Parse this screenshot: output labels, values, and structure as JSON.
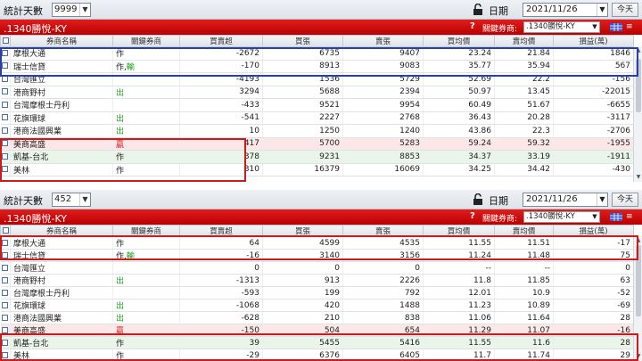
{
  "labels": {
    "days_label": "統計天數",
    "date_label": "日期",
    "today_button": "今天",
    "broker_label": "關鍵券商:",
    "help": "?"
  },
  "columns": [
    "券商名稱",
    "關鍵券商",
    "買賣超",
    "買張",
    "賣張",
    "買均價",
    "賣均價",
    "損益(萬)"
  ],
  "panel1": {
    "days": "9999",
    "date": "2021/11/26",
    "stock": ".1340勝悅-KY",
    "broker_select": ".1340勝悅-KY",
    "rows": [
      {
        "name": "摩根大通",
        "key": "作",
        "net": "-2672",
        "buy": "6735",
        "sell": "9407",
        "bavg": "23.24",
        "savg": "21.84",
        "pl": "1846",
        "style": ""
      },
      {
        "name": "瑞士信貸",
        "key": "作,輸",
        "net": "-170",
        "buy": "8913",
        "sell": "9083",
        "bavg": "35.77",
        "savg": "35.94",
        "pl": "567",
        "style": ""
      },
      {
        "name": "台灣匯立",
        "key": "",
        "net": "-4193",
        "buy": "1536",
        "sell": "5729",
        "bavg": "52.69",
        "savg": "22.2",
        "pl": "-156",
        "style": ""
      },
      {
        "name": "港商野村",
        "key": "出",
        "net": "3294",
        "buy": "5688",
        "sell": "2394",
        "bavg": "50.97",
        "savg": "13.45",
        "pl": "-22015",
        "style": ""
      },
      {
        "name": "台灣摩根士丹利",
        "key": "",
        "net": "-433",
        "buy": "9521",
        "sell": "9954",
        "bavg": "60.49",
        "savg": "51.67",
        "pl": "-6655",
        "style": ""
      },
      {
        "name": "花旗環球",
        "key": "出",
        "net": "-541",
        "buy": "2227",
        "sell": "2768",
        "bavg": "36.43",
        "savg": "20.28",
        "pl": "-3117",
        "style": ""
      },
      {
        "name": "港商法國興業",
        "key": "出",
        "net": "10",
        "buy": "1250",
        "sell": "1240",
        "bavg": "43.86",
        "savg": "22.3",
        "pl": "-2706",
        "style": ""
      },
      {
        "name": "美商高盛",
        "key": "贏",
        "net": "417",
        "buy": "5700",
        "sell": "5283",
        "bavg": "59.24",
        "savg": "59.32",
        "pl": "-1955",
        "style": "red"
      },
      {
        "name": "凱基-台北",
        "key": "作",
        "net": "378",
        "buy": "9231",
        "sell": "8853",
        "bavg": "34.37",
        "savg": "33.19",
        "pl": "-1911",
        "style": "green"
      },
      {
        "name": "美林",
        "key": "作",
        "net": "310",
        "buy": "16379",
        "sell": "16069",
        "bavg": "34.25",
        "savg": "34.42",
        "pl": "-430",
        "style": ""
      }
    ]
  },
  "panel2": {
    "days": "452",
    "date": "2021/11/26",
    "stock": ".1340勝悅-KY",
    "broker_select": ".1340勝悅-KY",
    "rows": [
      {
        "name": "摩根大通",
        "key": "作",
        "net": "64",
        "buy": "4599",
        "sell": "4535",
        "bavg": "11.55",
        "savg": "11.51",
        "pl": "-17",
        "style": ""
      },
      {
        "name": "瑞士信貸",
        "key": "作,輸",
        "net": "-16",
        "buy": "3140",
        "sell": "3156",
        "bavg": "11.24",
        "savg": "11.48",
        "pl": "75",
        "style": ""
      },
      {
        "name": "台灣匯立",
        "key": "",
        "net": "0",
        "buy": "0",
        "sell": "0",
        "bavg": "--",
        "savg": "--",
        "pl": "0",
        "style": ""
      },
      {
        "name": "港商野村",
        "key": "出",
        "net": "-1313",
        "buy": "913",
        "sell": "2226",
        "bavg": "11.8",
        "savg": "11.85",
        "pl": "63",
        "style": ""
      },
      {
        "name": "台灣摩根士丹利",
        "key": "",
        "net": "-593",
        "buy": "199",
        "sell": "792",
        "bavg": "12.01",
        "savg": "10.9",
        "pl": "-52",
        "style": ""
      },
      {
        "name": "花旗環球",
        "key": "出",
        "net": "-1068",
        "buy": "420",
        "sell": "1488",
        "bavg": "11.23",
        "savg": "10.89",
        "pl": "-69",
        "style": ""
      },
      {
        "name": "港商法國興業",
        "key": "出",
        "net": "-628",
        "buy": "210",
        "sell": "838",
        "bavg": "11.06",
        "savg": "11.64",
        "pl": "28",
        "style": ""
      },
      {
        "name": "美商高盛",
        "key": "贏",
        "net": "-150",
        "buy": "504",
        "sell": "654",
        "bavg": "11.29",
        "savg": "11.07",
        "pl": "-16",
        "style": "red"
      },
      {
        "name": "凱基-台北",
        "key": "作",
        "net": "39",
        "buy": "5455",
        "sell": "5416",
        "bavg": "11.55",
        "savg": "11.6",
        "pl": "28",
        "style": "green"
      },
      {
        "name": "美林",
        "key": "作",
        "net": "-29",
        "buy": "6376",
        "sell": "6405",
        "bavg": "11.7",
        "savg": "11.74",
        "pl": "29",
        "style": ""
      }
    ]
  },
  "icons": {
    "lock": "unlock-icon",
    "grid": "grid-icon",
    "menu": "menu-icon"
  },
  "colors": {
    "title_red": "#d21414",
    "highlight_blue": "#2b3fa8",
    "highlight_red": "#d11919",
    "buy_green": "#19a019"
  }
}
